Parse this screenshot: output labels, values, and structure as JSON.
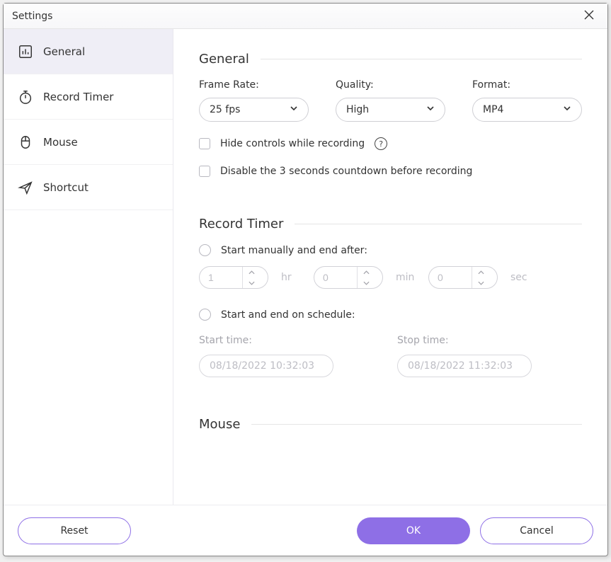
{
  "window": {
    "title": "Settings"
  },
  "sidebar": {
    "items": [
      {
        "label": "General"
      },
      {
        "label": "Record Timer"
      },
      {
        "label": "Mouse"
      },
      {
        "label": "Shortcut"
      }
    ]
  },
  "general": {
    "heading": "General",
    "frame_rate_label": "Frame Rate:",
    "frame_rate_value": "25 fps",
    "quality_label": "Quality:",
    "quality_value": "High",
    "format_label": "Format:",
    "format_value": "MP4",
    "hide_controls_label": "Hide controls while recording",
    "disable_countdown_label": "Disable the 3 seconds countdown before recording"
  },
  "record_timer": {
    "heading": "Record Timer",
    "manual_label": "Start manually and end after:",
    "hr_value": "1",
    "hr_unit": "hr",
    "min_value": "0",
    "min_unit": "min",
    "sec_value": "0",
    "sec_unit": "sec",
    "schedule_label": "Start and end on schedule:",
    "start_time_label": "Start time:",
    "start_time_value": "08/18/2022 10:32:03",
    "stop_time_label": "Stop time:",
    "stop_time_value": "08/18/2022 11:32:03"
  },
  "mouse": {
    "heading": "Mouse"
  },
  "footer": {
    "reset": "Reset",
    "ok": "OK",
    "cancel": "Cancel"
  }
}
